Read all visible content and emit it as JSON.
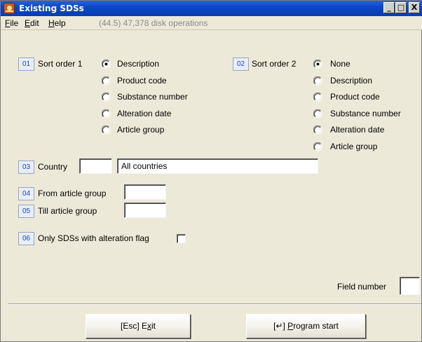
{
  "window": {
    "title": "Existing SDSs",
    "controls": {
      "minimize": "_",
      "maximize": "□",
      "close": "X"
    }
  },
  "menu": {
    "file": "F",
    "file_rest": "ile",
    "edit": "E",
    "edit_rest": "dit",
    "help": "H",
    "help_rest": "elp",
    "status": "(44.5) 47,378 disk operations"
  },
  "sort1": {
    "num": "01",
    "label": "Sort order 1",
    "options": [
      "Description",
      "Product code",
      "Substance number",
      "Alteration date",
      "Article group"
    ],
    "selected": "Description"
  },
  "sort2": {
    "num": "02",
    "label": "Sort order 2",
    "options": [
      "None",
      "Description",
      "Product code",
      "Substance number",
      "Alteration date",
      "Article group"
    ],
    "selected": "None"
  },
  "country": {
    "num": "03",
    "label": "Country",
    "code": "",
    "name": "All countries"
  },
  "from_group": {
    "num": "04",
    "label": "From article group",
    "value": ""
  },
  "till_group": {
    "num": "05",
    "label": "Till article group",
    "value": ""
  },
  "alteration": {
    "num": "06",
    "label": "Only SDSs with alteration flag",
    "checked": false
  },
  "field_number": {
    "label": "Field number",
    "value": ""
  },
  "buttons": {
    "exit_prefix": "[Esc] E",
    "exit_u": "x",
    "exit_suffix": "it",
    "start_prefix": "[↵] ",
    "start_u": "P",
    "start_suffix": "rogram start"
  }
}
